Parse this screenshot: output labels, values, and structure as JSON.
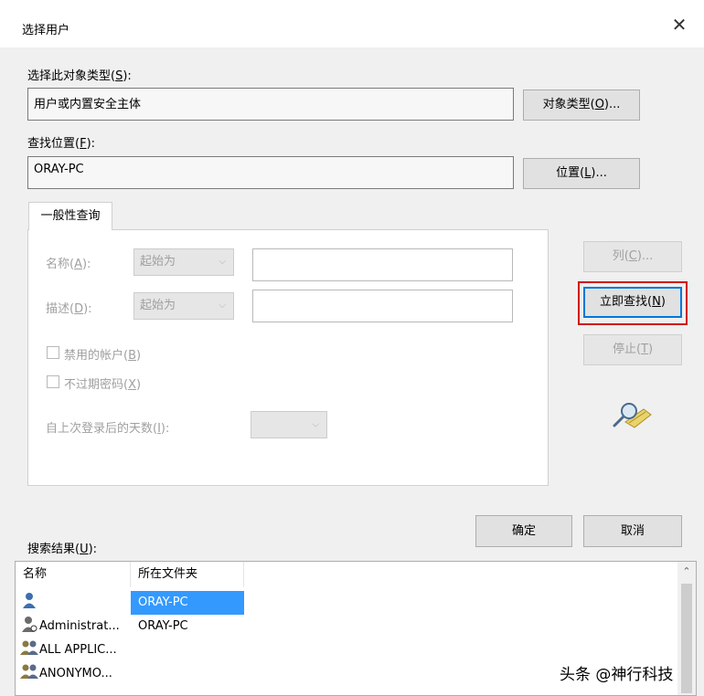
{
  "window": {
    "title": "选择用户"
  },
  "object_type": {
    "label_prefix": "选择此对象类型(",
    "label_key": "S",
    "label_suffix": "):",
    "value": "用户或内置安全主体",
    "button_prefix": "对象类型(",
    "button_key": "O",
    "button_suffix": ")..."
  },
  "location": {
    "label_prefix": "查找位置(",
    "label_key": "F",
    "label_suffix": "):",
    "value": "ORAY-PC",
    "button_prefix": "位置(",
    "button_key": "L",
    "button_suffix": ")..."
  },
  "tab": {
    "label": "一般性查询"
  },
  "query": {
    "name_prefix": "名称(",
    "name_key": "A",
    "name_suffix": "):",
    "name_combo": "起始为",
    "desc_prefix": "描述(",
    "desc_key": "D",
    "desc_suffix": "):",
    "desc_combo": "起始为",
    "disabled_prefix": "禁用的帐户(",
    "disabled_key": "B",
    "disabled_suffix": ")",
    "nonexp_prefix": "不过期密码(",
    "nonexp_key": "X",
    "nonexp_suffix": ")",
    "days_prefix": "自上次登录后的天数(",
    "days_key": "I",
    "days_suffix": "):"
  },
  "side_buttons": {
    "columns_prefix": "列(",
    "columns_key": "C",
    "columns_suffix": ")...",
    "find_prefix": "立即查找(",
    "find_key": "N",
    "find_suffix": ")",
    "stop_prefix": "停止(",
    "stop_key": "T",
    "stop_suffix": ")"
  },
  "actions": {
    "ok": "确定",
    "cancel": "取消"
  },
  "results": {
    "label_prefix": "搜索结果(",
    "label_key": "U",
    "label_suffix": "):",
    "columns": [
      "名称",
      "所在文件夹"
    ],
    "rows": [
      {
        "name": "...",
        "folder": "ORAY-PC"
      },
      {
        "name": "Administrat...",
        "folder": "ORAY-PC"
      },
      {
        "name": "ALL APPLIC...",
        "folder": ""
      },
      {
        "name": "ANONYMO...",
        "folder": ""
      }
    ]
  },
  "watermark": "头条 @神行科技",
  "colors": {
    "accent": "#0078d7",
    "selection": "#3399ff",
    "highlight_box": "#d01010"
  }
}
